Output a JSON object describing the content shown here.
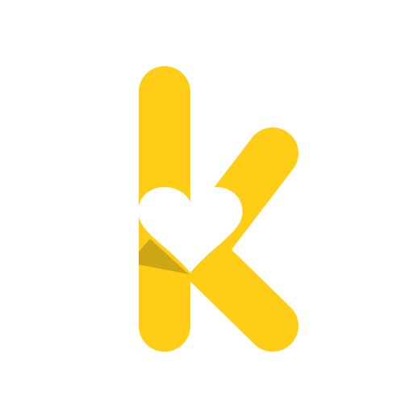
{
  "logo": {
    "icon": "k-heart-logo-icon",
    "colors": {
      "primary": "#FFCC16",
      "shadow": "#CCA614",
      "background": "#FFFFFF"
    }
  }
}
